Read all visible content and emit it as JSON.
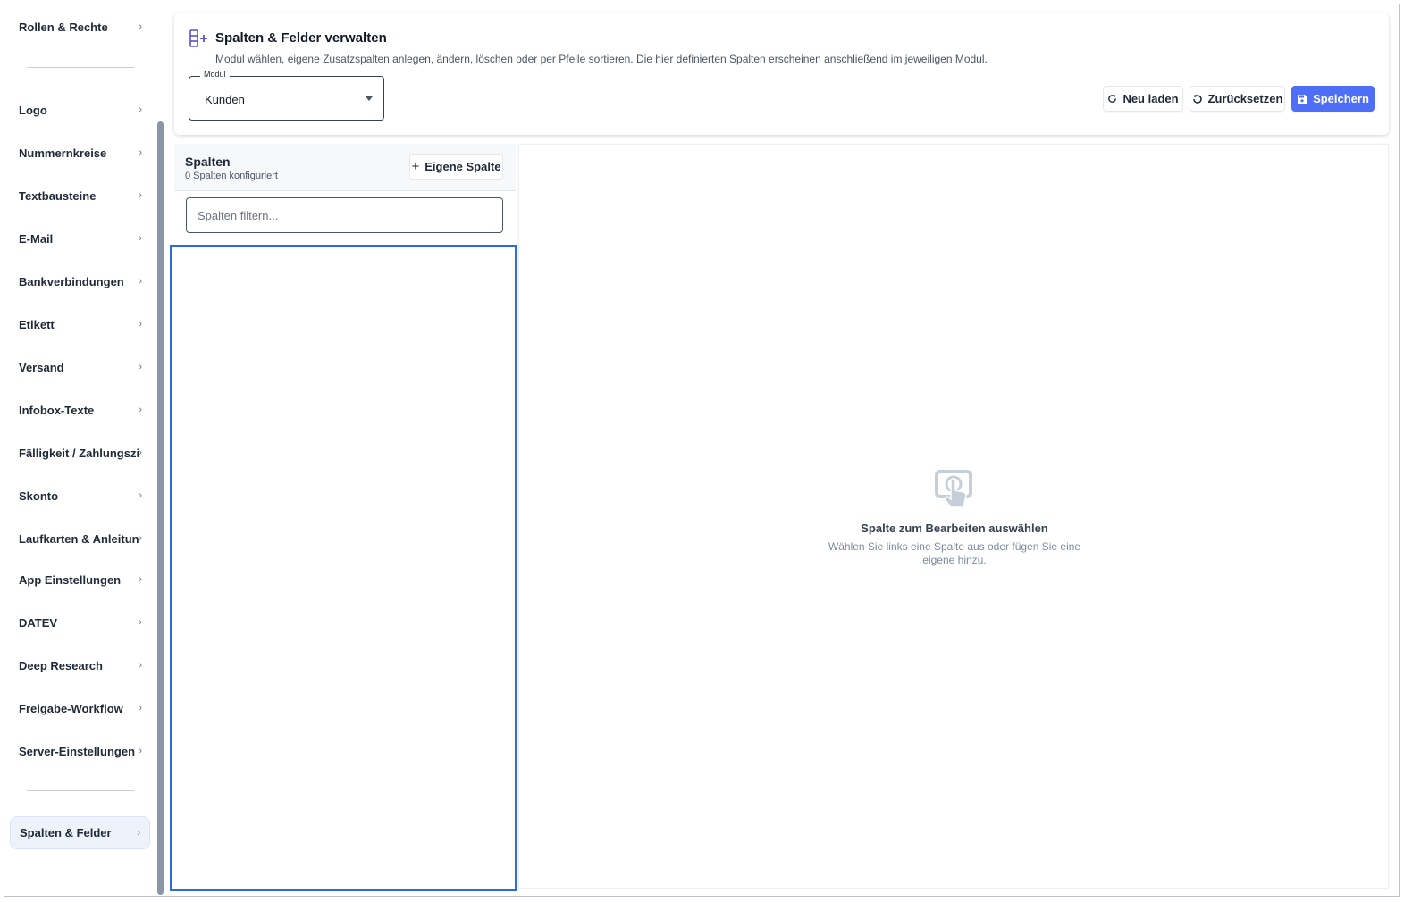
{
  "sidebar": {
    "items": [
      {
        "label": "Rollen & Rechte",
        "chevron": "›"
      },
      {
        "label": "Logo",
        "chevron": "›"
      },
      {
        "label": "Nummernkreise",
        "chevron": "›"
      },
      {
        "label": "Textbausteine",
        "chevron": "›"
      },
      {
        "label": "E-Mail",
        "chevron": "›"
      },
      {
        "label": "Bankverbindungen",
        "chevron": "›"
      },
      {
        "label": "Etikett",
        "chevron": "›"
      },
      {
        "label": "Versand",
        "chevron": "›"
      },
      {
        "label": "Infobox-Texte",
        "chevron": "›"
      },
      {
        "label": "Fälligkeit / Zahlungsziele",
        "chevron": "›"
      },
      {
        "label": "Skonto",
        "chevron": "›"
      },
      {
        "label": "Laufkarten & Anleitungen",
        "chevron": "›"
      },
      {
        "label": "App Einstellungen",
        "chevron": "›"
      },
      {
        "label": "DATEV",
        "chevron": "›"
      },
      {
        "label": "Deep Research",
        "chevron": "›"
      },
      {
        "label": "Freigabe-Workflow",
        "chevron": "›"
      },
      {
        "label": "Server-Einstellungen",
        "chevron": "›"
      }
    ],
    "active_item": {
      "label": "Spalten & Felder",
      "chevron": "›"
    }
  },
  "header": {
    "title": "Spalten & Felder verwalten",
    "description": "Modul wählen, eigene Zusatzspalten anlegen, ändern, löschen oder per Pfeile sortieren. Die hier definierten Spalten erscheinen anschließend im jeweiligen Modul.",
    "icon": "columns-add-icon",
    "module_select": {
      "legend": "Modul",
      "value": "Kunden"
    },
    "buttons": {
      "reload": "Neu laden",
      "reset": "Zurücksetzen",
      "save": "Speichern"
    }
  },
  "columns_panel": {
    "title": "Spalten",
    "subtitle": "0 Spalten konfiguriert",
    "add_button": "Eigene Spalte",
    "filter_placeholder": "Spalten filtern..."
  },
  "editor_panel": {
    "empty_title": "Spalte zum Bearbeiten auswählen",
    "empty_desc": "Wählen Sie links eine Spalte aus oder fügen Sie eine eigene hinzu."
  },
  "colors": {
    "accent": "#4f6ef7",
    "highlight_border": "#2e6bd6",
    "icon_purple": "#5b4fd6"
  }
}
